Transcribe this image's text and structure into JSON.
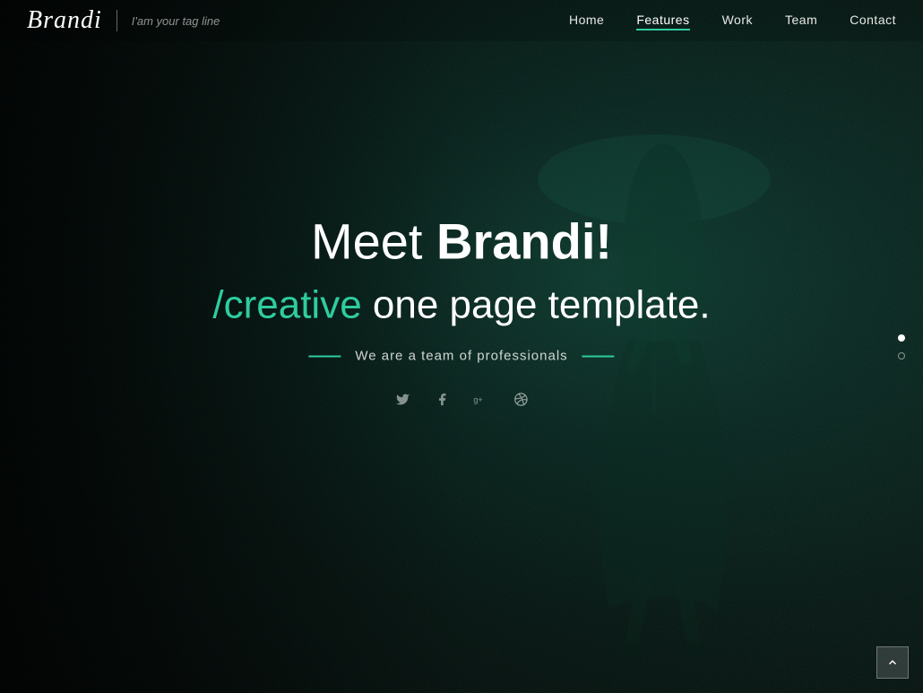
{
  "brand": {
    "logo": "Brandi",
    "tagline": "I'am your tag line"
  },
  "nav": {
    "links": [
      {
        "label": "Home",
        "active": false
      },
      {
        "label": "Features",
        "active": true
      },
      {
        "label": "Work",
        "active": false
      },
      {
        "label": "Team",
        "active": false
      },
      {
        "label": "Contact",
        "active": false
      }
    ]
  },
  "hero": {
    "title_prefix": "Meet ",
    "title_bold": "Brandi!",
    "subtitle_accent": "/creative",
    "subtitle_rest": " one page template.",
    "tagline": "We are a team of professionals",
    "scroll_dots": [
      {
        "state": "active"
      },
      {
        "state": "inactive"
      }
    ]
  },
  "social": {
    "icons": [
      {
        "name": "twitter",
        "symbol": "𝕋"
      },
      {
        "name": "facebook",
        "symbol": "𝕗"
      },
      {
        "name": "google-plus",
        "symbol": "𝔾"
      },
      {
        "name": "dribbble",
        "symbol": "◎"
      }
    ]
  },
  "colors": {
    "accent": "#2ecc9e",
    "background": "#041a14",
    "text": "#ffffff"
  }
}
